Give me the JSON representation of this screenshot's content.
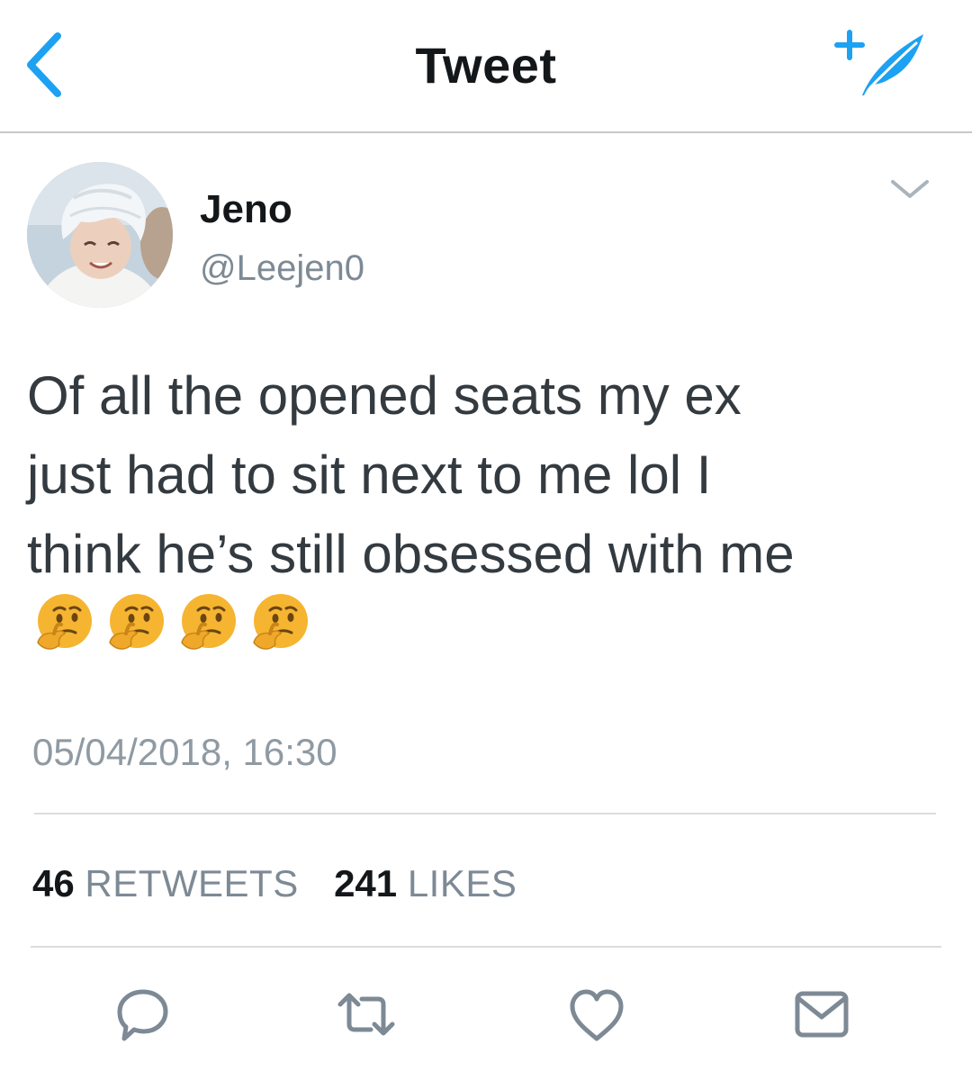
{
  "header": {
    "title": "Tweet",
    "back_icon": "chevron-left-icon",
    "compose_icon": "compose-feather-icon",
    "accent_color": "#1da1f2"
  },
  "tweet": {
    "author": {
      "display_name": "Jeno",
      "handle": "@Leejen0"
    },
    "text_lines": [
      "Of all the opened seats my ex",
      "just had to sit next to me lol I",
      "think he’s still obsessed with me"
    ],
    "emojis": [
      "🤔",
      "🤔",
      "🤔",
      "🤔"
    ],
    "timestamp": "05/04/2018, 16:30",
    "stats": {
      "retweets_count": "46",
      "retweets_label": "RETWEETS",
      "likes_count": "241",
      "likes_label": "LIKES"
    }
  },
  "actions": [
    {
      "name": "reply",
      "icon": "reply-icon"
    },
    {
      "name": "retweet",
      "icon": "retweet-icon"
    },
    {
      "name": "like",
      "icon": "heart-icon"
    },
    {
      "name": "share",
      "icon": "envelope-icon"
    }
  ],
  "colors": {
    "text_primary": "#14171a",
    "text_secondary": "#7d8a95",
    "icon_gray": "#7d8a95",
    "emoji_yellow": "#f5b531"
  }
}
